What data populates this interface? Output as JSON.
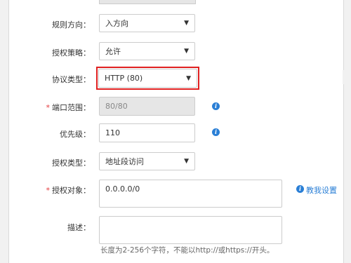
{
  "form": {
    "rule_direction": {
      "label": "规则方向：",
      "value": "入方向"
    },
    "auth_policy": {
      "label": "授权策略：",
      "value": "允许"
    },
    "protocol_type": {
      "label": "协议类型：",
      "value": "HTTP (80)"
    },
    "port_range": {
      "required_mark": "*",
      "label": "端口范围：",
      "value": "80/80"
    },
    "priority": {
      "label": "优先级：",
      "value": "110"
    },
    "auth_type": {
      "label": "授权类型：",
      "value": "地址段访问"
    },
    "auth_object": {
      "required_mark": "*",
      "label": "授权对象：",
      "value": "0.0.0.0/0",
      "help_link": "教我设置"
    },
    "description": {
      "label": "描述：",
      "value": "",
      "hint": "长度为2-256个字符，不能以http://或https://开头。"
    }
  },
  "icons": {
    "info": "info-icon",
    "caret": "caret-down-icon"
  },
  "colors": {
    "focus_border": "#e02020",
    "info": "#2a7fd6",
    "disabled_bg": "#e6e6e6",
    "required": "#e4393c"
  }
}
